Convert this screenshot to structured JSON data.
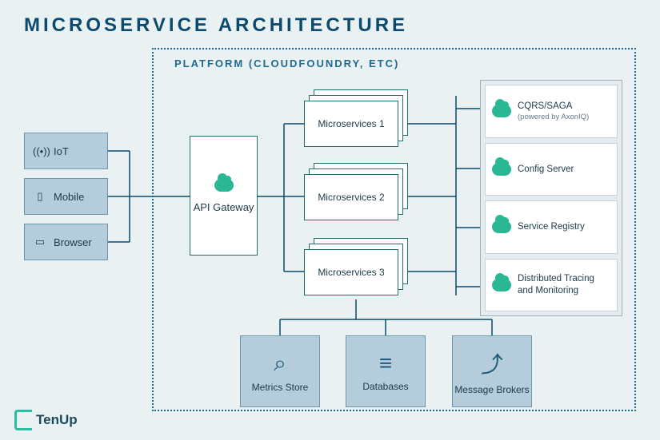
{
  "title": "MICROSERVICE ARCHITECTURE",
  "platform_label": "PLATFORM (CLOUDFOUNDRY, ETC)",
  "clients": {
    "iot": "IoT",
    "mobile": "Mobile",
    "browser": "Browser"
  },
  "api_gateway": "API Gateway",
  "microservices": {
    "ms1": "Microservices 1",
    "ms2": "Microservices 2",
    "ms3": "Microservices 3"
  },
  "right_services": {
    "cqrs": {
      "label": "CQRS/SAGA",
      "sub": "(powered by AxonIQ)"
    },
    "config": {
      "label": "Config Server"
    },
    "registry": {
      "label": "Service Registry"
    },
    "tracing": {
      "label": "Distributed Tracing and Monitoring"
    }
  },
  "bottom": {
    "metrics": "Metrics Store",
    "databases": "Databases",
    "brokers": "Message Brokers"
  },
  "branding": "TenUp"
}
